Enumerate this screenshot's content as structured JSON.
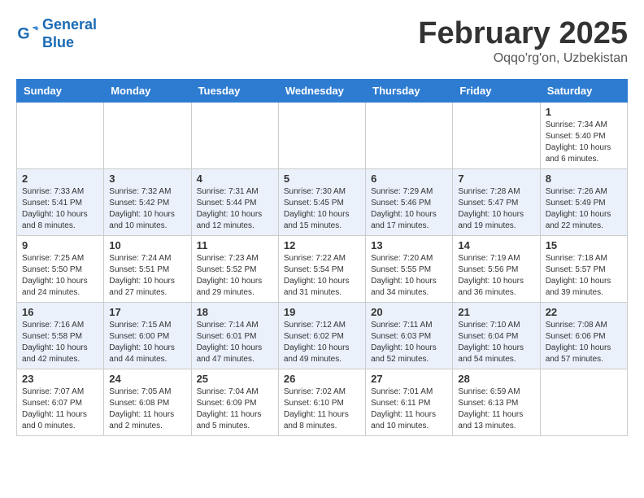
{
  "header": {
    "logo_line1": "General",
    "logo_line2": "Blue",
    "month_title": "February 2025",
    "location": "Oqqo'rg'on, Uzbekistan"
  },
  "weekdays": [
    "Sunday",
    "Monday",
    "Tuesday",
    "Wednesday",
    "Thursday",
    "Friday",
    "Saturday"
  ],
  "weeks": [
    [
      {
        "day": "",
        "info": ""
      },
      {
        "day": "",
        "info": ""
      },
      {
        "day": "",
        "info": ""
      },
      {
        "day": "",
        "info": ""
      },
      {
        "day": "",
        "info": ""
      },
      {
        "day": "",
        "info": ""
      },
      {
        "day": "1",
        "info": "Sunrise: 7:34 AM\nSunset: 5:40 PM\nDaylight: 10 hours and 6 minutes."
      }
    ],
    [
      {
        "day": "2",
        "info": "Sunrise: 7:33 AM\nSunset: 5:41 PM\nDaylight: 10 hours and 8 minutes."
      },
      {
        "day": "3",
        "info": "Sunrise: 7:32 AM\nSunset: 5:42 PM\nDaylight: 10 hours and 10 minutes."
      },
      {
        "day": "4",
        "info": "Sunrise: 7:31 AM\nSunset: 5:44 PM\nDaylight: 10 hours and 12 minutes."
      },
      {
        "day": "5",
        "info": "Sunrise: 7:30 AM\nSunset: 5:45 PM\nDaylight: 10 hours and 15 minutes."
      },
      {
        "day": "6",
        "info": "Sunrise: 7:29 AM\nSunset: 5:46 PM\nDaylight: 10 hours and 17 minutes."
      },
      {
        "day": "7",
        "info": "Sunrise: 7:28 AM\nSunset: 5:47 PM\nDaylight: 10 hours and 19 minutes."
      },
      {
        "day": "8",
        "info": "Sunrise: 7:26 AM\nSunset: 5:49 PM\nDaylight: 10 hours and 22 minutes."
      }
    ],
    [
      {
        "day": "9",
        "info": "Sunrise: 7:25 AM\nSunset: 5:50 PM\nDaylight: 10 hours and 24 minutes."
      },
      {
        "day": "10",
        "info": "Sunrise: 7:24 AM\nSunset: 5:51 PM\nDaylight: 10 hours and 27 minutes."
      },
      {
        "day": "11",
        "info": "Sunrise: 7:23 AM\nSunset: 5:52 PM\nDaylight: 10 hours and 29 minutes."
      },
      {
        "day": "12",
        "info": "Sunrise: 7:22 AM\nSunset: 5:54 PM\nDaylight: 10 hours and 31 minutes."
      },
      {
        "day": "13",
        "info": "Sunrise: 7:20 AM\nSunset: 5:55 PM\nDaylight: 10 hours and 34 minutes."
      },
      {
        "day": "14",
        "info": "Sunrise: 7:19 AM\nSunset: 5:56 PM\nDaylight: 10 hours and 36 minutes."
      },
      {
        "day": "15",
        "info": "Sunrise: 7:18 AM\nSunset: 5:57 PM\nDaylight: 10 hours and 39 minutes."
      }
    ],
    [
      {
        "day": "16",
        "info": "Sunrise: 7:16 AM\nSunset: 5:58 PM\nDaylight: 10 hours and 42 minutes."
      },
      {
        "day": "17",
        "info": "Sunrise: 7:15 AM\nSunset: 6:00 PM\nDaylight: 10 hours and 44 minutes."
      },
      {
        "day": "18",
        "info": "Sunrise: 7:14 AM\nSunset: 6:01 PM\nDaylight: 10 hours and 47 minutes."
      },
      {
        "day": "19",
        "info": "Sunrise: 7:12 AM\nSunset: 6:02 PM\nDaylight: 10 hours and 49 minutes."
      },
      {
        "day": "20",
        "info": "Sunrise: 7:11 AM\nSunset: 6:03 PM\nDaylight: 10 hours and 52 minutes."
      },
      {
        "day": "21",
        "info": "Sunrise: 7:10 AM\nSunset: 6:04 PM\nDaylight: 10 hours and 54 minutes."
      },
      {
        "day": "22",
        "info": "Sunrise: 7:08 AM\nSunset: 6:06 PM\nDaylight: 10 hours and 57 minutes."
      }
    ],
    [
      {
        "day": "23",
        "info": "Sunrise: 7:07 AM\nSunset: 6:07 PM\nDaylight: 11 hours and 0 minutes."
      },
      {
        "day": "24",
        "info": "Sunrise: 7:05 AM\nSunset: 6:08 PM\nDaylight: 11 hours and 2 minutes."
      },
      {
        "day": "25",
        "info": "Sunrise: 7:04 AM\nSunset: 6:09 PM\nDaylight: 11 hours and 5 minutes."
      },
      {
        "day": "26",
        "info": "Sunrise: 7:02 AM\nSunset: 6:10 PM\nDaylight: 11 hours and 8 minutes."
      },
      {
        "day": "27",
        "info": "Sunrise: 7:01 AM\nSunset: 6:11 PM\nDaylight: 11 hours and 10 minutes."
      },
      {
        "day": "28",
        "info": "Sunrise: 6:59 AM\nSunset: 6:13 PM\nDaylight: 11 hours and 13 minutes."
      },
      {
        "day": "",
        "info": ""
      }
    ]
  ]
}
